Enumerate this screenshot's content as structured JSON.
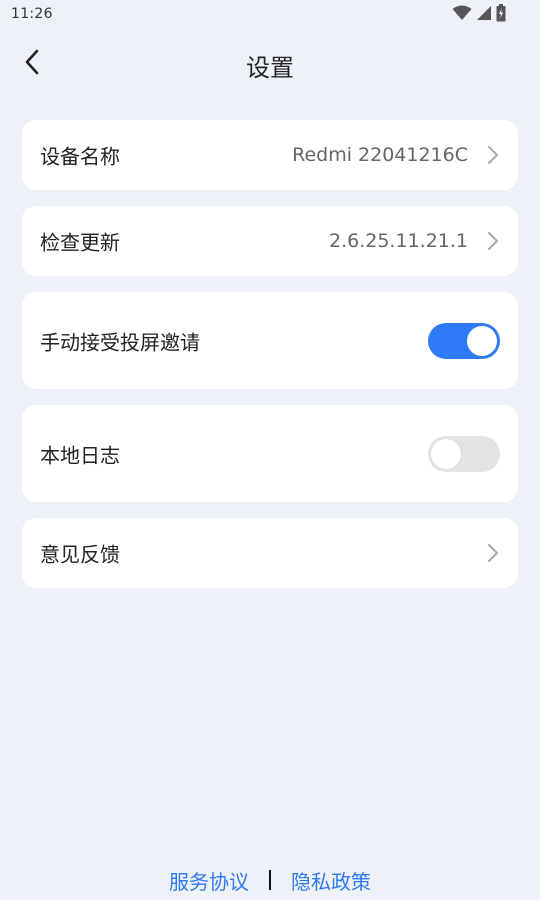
{
  "status_bar": {
    "time": "11:26",
    "icons": [
      "wifi-icon",
      "signal-icon",
      "battery-charging-icon"
    ]
  },
  "header": {
    "title": "设置",
    "back_icon": "chevron-left-icon"
  },
  "settings": {
    "device_name": {
      "label": "设备名称",
      "value": "Redmi 22041216C"
    },
    "check_update": {
      "label": "检查更新",
      "value": "2.6.25.11.21.1"
    },
    "manual_accept": {
      "label": "手动接受投屏邀请",
      "enabled": true
    },
    "local_log": {
      "label": "本地日志",
      "enabled": false
    },
    "feedback": {
      "label": "意见反馈"
    }
  },
  "footer": {
    "service_agreement": "服务协议",
    "privacy_policy": "隐私政策"
  },
  "colors": {
    "background": "#eef2f8",
    "accent": "#2f7bf5",
    "card": "#ffffff",
    "toggle_off": "#e3e3e3"
  }
}
